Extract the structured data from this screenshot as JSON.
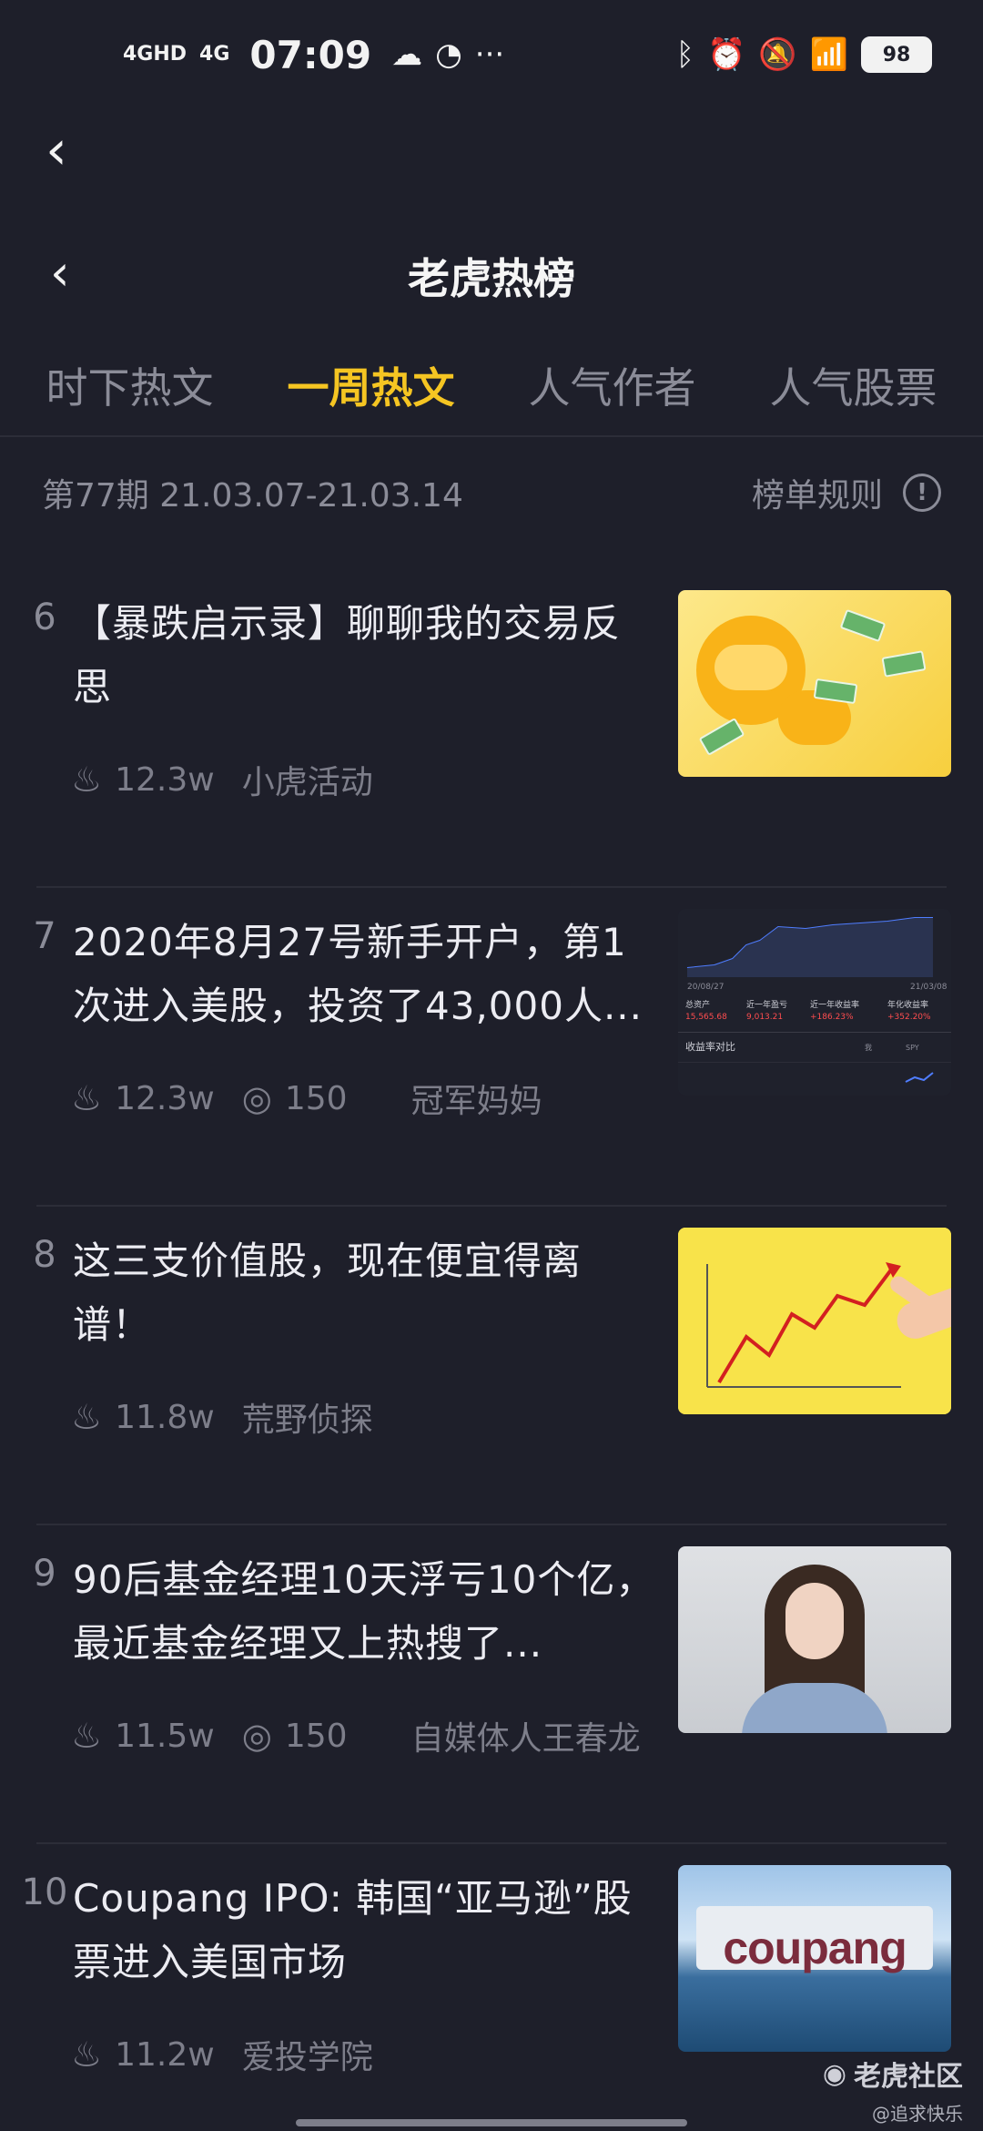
{
  "status_bar": {
    "signal1": "4GHD",
    "signal2": "4G",
    "time": "07:09",
    "dots": "···",
    "battery": "98"
  },
  "header": {
    "title": "老虎热榜"
  },
  "tabs": [
    {
      "label": "时下热文",
      "active": false
    },
    {
      "label": "一周热文",
      "active": true
    },
    {
      "label": "人气作者",
      "active": false
    },
    {
      "label": "人气股票",
      "active": false
    }
  ],
  "period": {
    "label": "第77期 21.03.07-21.03.14",
    "rules_label": "榜单规则",
    "rules_icon": "!"
  },
  "articles": [
    {
      "rank": "6",
      "title": "【暴跌启示录】聊聊我的交易反思",
      "heat": "12.3w",
      "comments": "",
      "author": "小虎活动",
      "thumb": "tiger"
    },
    {
      "rank": "7",
      "title": "2020年8月27号新手开户，第1次进入美股，投资了43,000人...",
      "heat": "12.3w",
      "comments": "150",
      "author": "冠军妈妈",
      "thumb": "chart"
    },
    {
      "rank": "8",
      "title": "这三支价值股，现在便宜得离谱！",
      "heat": "11.8w",
      "comments": "",
      "author": "荒野侦探",
      "thumb": "yellow"
    },
    {
      "rank": "9",
      "title": "90后基金经理10天浮亏10个亿，最近基金经理又上热搜了...",
      "heat": "11.5w",
      "comments": "150",
      "author": "自媒体人王春龙",
      "thumb": "woman"
    },
    {
      "rank": "10",
      "title": "Coupang IPO: 韩国“亚马逊”股票进入美国市场",
      "heat": "11.2w",
      "comments": "",
      "author": "爱投学院",
      "thumb": "coupang"
    }
  ],
  "thumb_chart": {
    "date_start": "20/08/27",
    "date_end": "21/03/08",
    "stats": [
      {
        "label": "总资产",
        "value": "15,565.68"
      },
      {
        "label": "近一年盈亏",
        "value": "9,013.21"
      },
      {
        "label": "近一年收益率",
        "value": "+186.23%"
      },
      {
        "label": "年化收益率",
        "value": "+352.20%"
      }
    ],
    "compare_label": "收益率对比",
    "legend1": "我",
    "legend2": "SPY"
  },
  "thumb_coupang": {
    "text": "coupang"
  },
  "watermark": {
    "main": "老虎社区",
    "sub": "@追求快乐"
  },
  "colors": {
    "accent": "#f5c522",
    "background": "#1e1f2a",
    "muted": "#8b8c98"
  }
}
